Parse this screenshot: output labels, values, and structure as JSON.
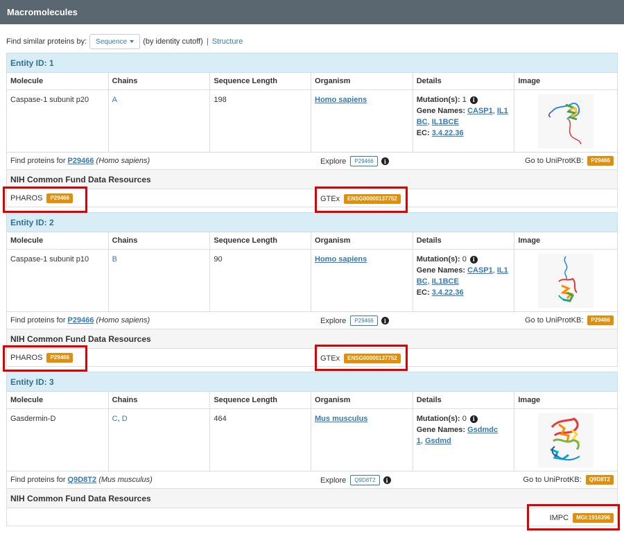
{
  "header": {
    "title": "Macromolecules"
  },
  "find_similar": {
    "label": "Find similar proteins by:",
    "sequence_btn": "Sequence",
    "identity": "(by identity cutoff)",
    "separator": "|",
    "structure_link": "Structure"
  },
  "columns": [
    "Molecule",
    "Chains",
    "Sequence Length",
    "Organism",
    "Details",
    "Image"
  ],
  "labels": {
    "find_proteins_for": "Find proteins for",
    "explore": "Explore",
    "go_uniprot": "Go to UniProtKB:",
    "nih": "NIH Common Fund Data Resources",
    "pharos": "PHAROS",
    "gtex": "GTEx",
    "impc": "IMPC",
    "mutations": "Mutation(s):",
    "gene_names": "Gene Names:",
    "ec": "EC:",
    "comma": ","
  },
  "entities": [
    {
      "title": "Entity ID: 1",
      "molecule": "Caspase-1 subunit p20",
      "chains": [
        "A"
      ],
      "seq_length": "198",
      "organism": "Homo sapiens",
      "mutations": "1",
      "gene_names": [
        "CASP1",
        "IL1",
        "BC",
        "IL1BCE"
      ],
      "ec": "3.4.22.36",
      "uniprot": "P29466",
      "organism_paren": "(Homo sapiens)",
      "pharos": "P29466",
      "gtex": "ENSG00000137752"
    },
    {
      "title": "Entity ID: 2",
      "molecule": "Caspase-1 subunit p10",
      "chains": [
        "B"
      ],
      "seq_length": "90",
      "organism": "Homo sapiens",
      "mutations": "0",
      "gene_names": [
        "CASP1",
        "IL1",
        "BC",
        "IL1BCE"
      ],
      "ec": "3.4.22.36",
      "uniprot": "P29466",
      "organism_paren": "(Homo sapiens)",
      "pharos": "P29466",
      "gtex": "ENSG00000137752"
    },
    {
      "title": "Entity ID: 3",
      "molecule": "Gasdermin-D",
      "chains": [
        "C",
        "D"
      ],
      "seq_length": "464",
      "organism": "Mus musculus",
      "mutations": "0",
      "gene_names": [
        "Gsdmdc",
        "1",
        "Gsdmd"
      ],
      "uniprot": "Q9D8T2",
      "organism_paren": "(Mus musculus)",
      "impc": "MGI:1916396"
    }
  ],
  "colors": {
    "header_bg": "#5b6770",
    "entity_bg": "#d9edf7",
    "link": "#337ab7",
    "badge_orange": "#e08e0b",
    "highlight_red": "#e00000"
  }
}
